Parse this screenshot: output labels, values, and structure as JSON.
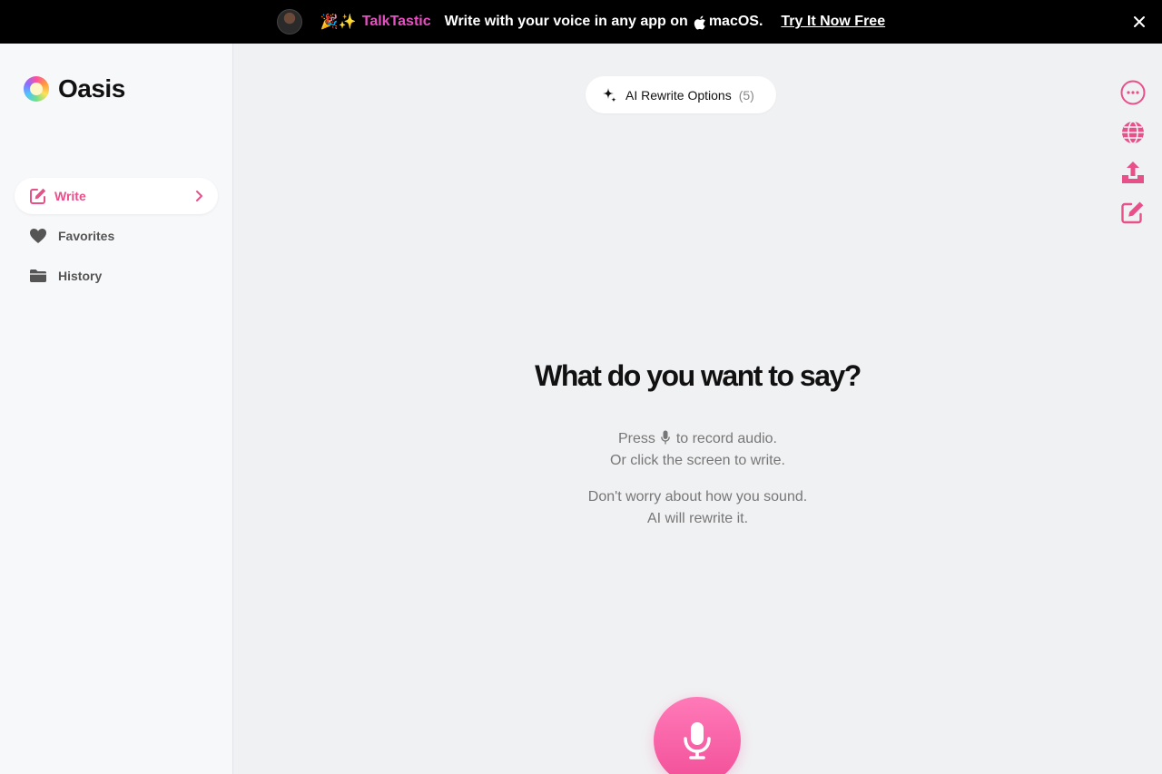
{
  "banner": {
    "emoji": "🎉✨",
    "brand": "TalkTastic",
    "message_prefix": "Write with your voice in any app on",
    "message_os": "macOS.",
    "cta": "Try It Now Free"
  },
  "sidebar": {
    "logo_text": "Oasis",
    "items": [
      {
        "label": "Write",
        "icon": "edit-icon",
        "active": true
      },
      {
        "label": "Favorites",
        "icon": "heart-icon",
        "active": false
      },
      {
        "label": "History",
        "icon": "folder-icon",
        "active": false
      }
    ]
  },
  "main": {
    "rewrite_label": "AI Rewrite Options",
    "rewrite_count": "(5)",
    "title": "What do you want to say?",
    "press_before": "Press",
    "press_after": "to record audio.",
    "click_line": "Or click the screen to write.",
    "worry_line": "Don't worry about how you sound.",
    "rewrite_line": "AI will rewrite it."
  },
  "tools": [
    "more-icon",
    "globe-icon",
    "share-icon",
    "new-note-icon"
  ],
  "colors": {
    "accent": "#e8508a",
    "brand": "#e94fc4",
    "mic": "#f24f98"
  }
}
